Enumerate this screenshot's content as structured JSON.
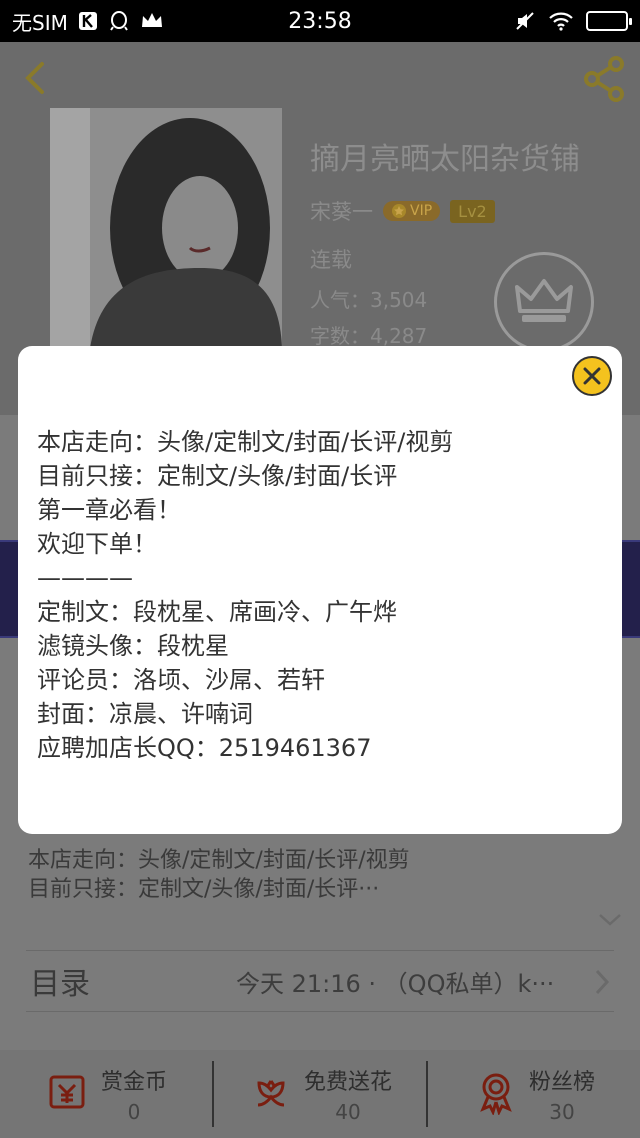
{
  "status_bar": {
    "carrier": "无SIM",
    "time": "23:58"
  },
  "book": {
    "title": "摘月亮晒太阳杂货铺",
    "author": "宋葵一",
    "vip_label": "VIP",
    "level": "Lv2",
    "status": "连载",
    "popularity": "人气：3,504",
    "word_count": "字数：4,287"
  },
  "intro_preview": [
    "本店走向：头像/定制文/封面/长评/视剪",
    "目前只接：定制文/头像/封面/长评···"
  ],
  "toc": {
    "label": "目录",
    "latest": "今天 21:16 · （QQ私单）k···"
  },
  "footer": {
    "items": [
      {
        "label": "赏金币",
        "value": "0",
        "icon": "coin-envelope-icon"
      },
      {
        "label": "免费送花",
        "value": "40",
        "icon": "flower-icon"
      },
      {
        "label": "粉丝榜",
        "value": "30",
        "icon": "ribbon-medal-icon"
      }
    ]
  },
  "modal": {
    "lines": [
      "本店走向：头像/定制文/封面/长评/视剪",
      "目前只接：定制文/头像/封面/长评",
      "第一章必看！",
      "欢迎下单！",
      "————",
      "定制文：段枕星、席画冷、广午烨",
      "滤镜头像：段枕星",
      "评论员：洛顷、沙屌、若轩",
      "封面：凉晨、许喃词",
      "应聘加店长QQ：2519461367"
    ]
  },
  "colors": {
    "accent": "#f4c21e",
    "modal_bg": "#ffffff",
    "dim_bg": "#7b7b7b"
  }
}
